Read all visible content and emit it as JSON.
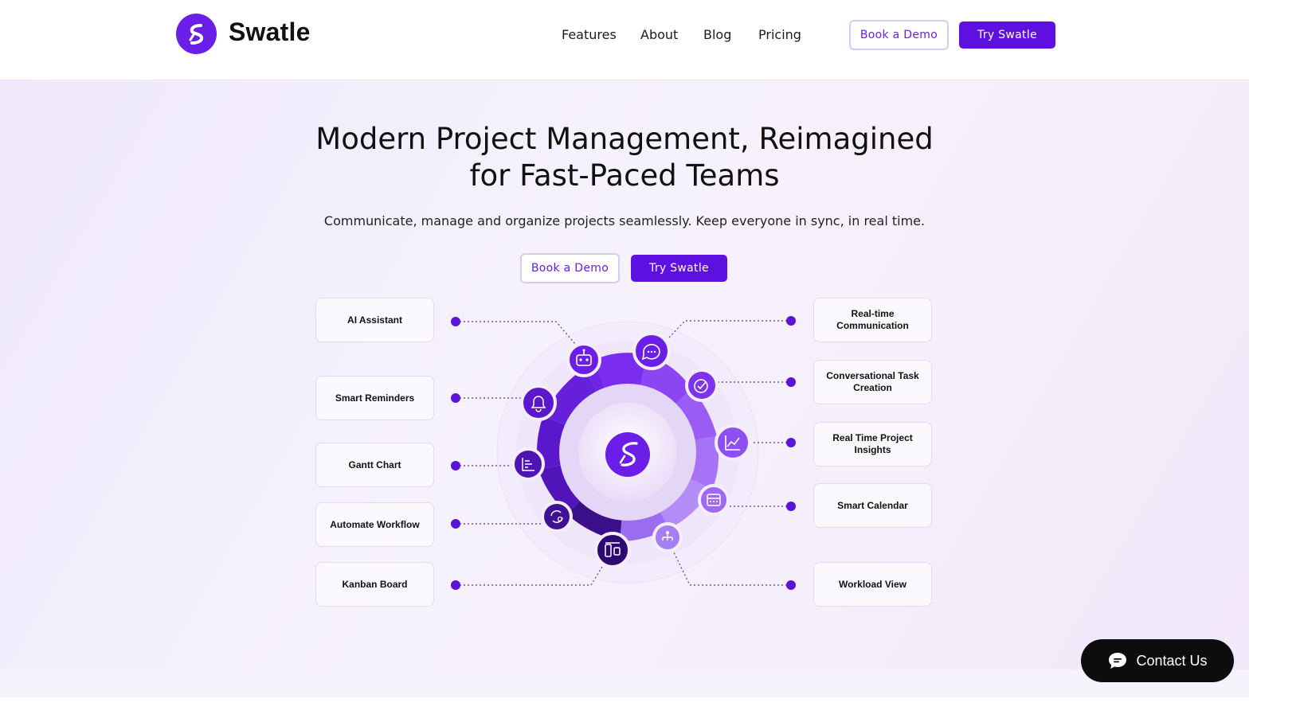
{
  "brand": {
    "name": "Swatle",
    "logo_icon": "swatle-s-logo-icon",
    "accent": "#5e10e0"
  },
  "nav": {
    "items": [
      {
        "label": "Features"
      },
      {
        "label": "About"
      },
      {
        "label": "Blog"
      },
      {
        "label": "Pricing"
      }
    ],
    "book_demo_label": "Book a Demo",
    "try_label": "Try Swatle"
  },
  "hero": {
    "title_line1": "Modern Project Management, Reimagined",
    "title_line2": "for Fast-Paced Teams",
    "subtitle": "Communicate, manage and organize projects seamlessly. Keep everyone in sync, in real time.",
    "book_demo_label": "Book a Demo",
    "try_label": "Try Swatle"
  },
  "features": {
    "left": [
      {
        "label": "AI Assistant",
        "icon": "robot-icon"
      },
      {
        "label": "Smart Reminders",
        "icon": "bell-icon"
      },
      {
        "label": "Gantt Chart",
        "icon": "gantt-chart-icon"
      },
      {
        "label": "Automate Workflow",
        "icon": "workflow-gear-icon"
      },
      {
        "label": "Kanban Board",
        "icon": "kanban-icon"
      }
    ],
    "right": [
      {
        "label": "Real-time Communication",
        "icon": "chat-bubble-icon"
      },
      {
        "label": "Conversational Task Creation",
        "icon": "task-check-icon"
      },
      {
        "label": "Real Time Project Insights",
        "icon": "line-chart-icon"
      },
      {
        "label": "Smart Calendar",
        "icon": "calendar-icon"
      },
      {
        "label": "Workload View",
        "icon": "hierarchy-icon"
      }
    ]
  },
  "contact": {
    "label": "Contact Us",
    "icon": "chat-icon"
  }
}
